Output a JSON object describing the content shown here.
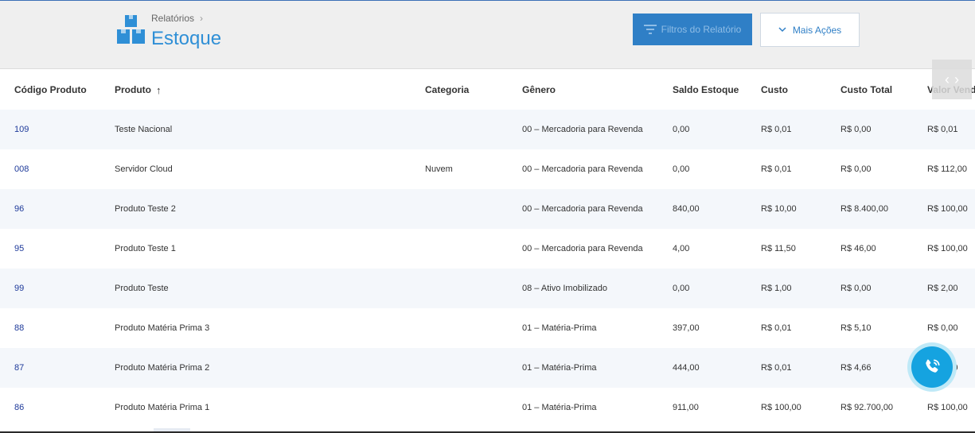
{
  "header": {
    "breadcrumb": "Relatórios",
    "breadcrumb_separator": "›",
    "title": "Estoque",
    "filter_button": "Filtros do Relatório",
    "more_button": "Mais Ações",
    "title_icon": "boxes-icon",
    "accent_color": "#2f8fd6"
  },
  "table": {
    "columns": [
      "Código Produto",
      "Produto",
      "Categoria",
      "Gênero",
      "Saldo Estoque",
      "Custo",
      "Custo Total",
      "Valor Venda"
    ],
    "sorted_column": "Produto",
    "sort_direction": "ascending",
    "rows": [
      [
        "109",
        "Teste Nacional",
        "",
        "00 – Mercadoria para Revenda",
        "0,00",
        "R$ 0,01",
        "R$ 0,00",
        "R$ 0,01"
      ],
      [
        "008",
        "Servidor Cloud",
        "Nuvem",
        "00 – Mercadoria para Revenda",
        "0,00",
        "R$ 0,01",
        "R$ 0,00",
        "R$ 112,00"
      ],
      [
        "96",
        "Produto Teste 2",
        "",
        "00 – Mercadoria para Revenda",
        "840,00",
        "R$ 10,00",
        "R$ 8.400,00",
        "R$ 100,00"
      ],
      [
        "95",
        "Produto Teste 1",
        "",
        "00 – Mercadoria para Revenda",
        "4,00",
        "R$ 11,50",
        "R$ 46,00",
        "R$ 100,00"
      ],
      [
        "99",
        "Produto Teste",
        "",
        "08 – Ativo Imobilizado",
        "0,00",
        "R$ 1,00",
        "R$ 0,00",
        "R$ 2,00"
      ],
      [
        "88",
        "Produto Matéria Prima 3",
        "",
        "01 – Matéria-Prima",
        "397,00",
        "R$ 0,01",
        "R$ 5,10",
        "R$ 0,00"
      ],
      [
        "87",
        "Produto Matéria Prima 2",
        "",
        "01 – Matéria-Prima",
        "444,00",
        "R$ 0,01",
        "R$ 4,66",
        "R$ 0,00"
      ],
      [
        "86",
        "Produto Matéria Prima 1",
        "",
        "01 – Matéria-Prima",
        "911,00",
        "R$ 100,00",
        "R$ 92.700,00",
        "R$ 100,00"
      ]
    ]
  },
  "scroll_arrows": {
    "left": "‹",
    "right": "›"
  },
  "fab": {
    "icon": "phone-icon",
    "color": "#15a3e0"
  }
}
